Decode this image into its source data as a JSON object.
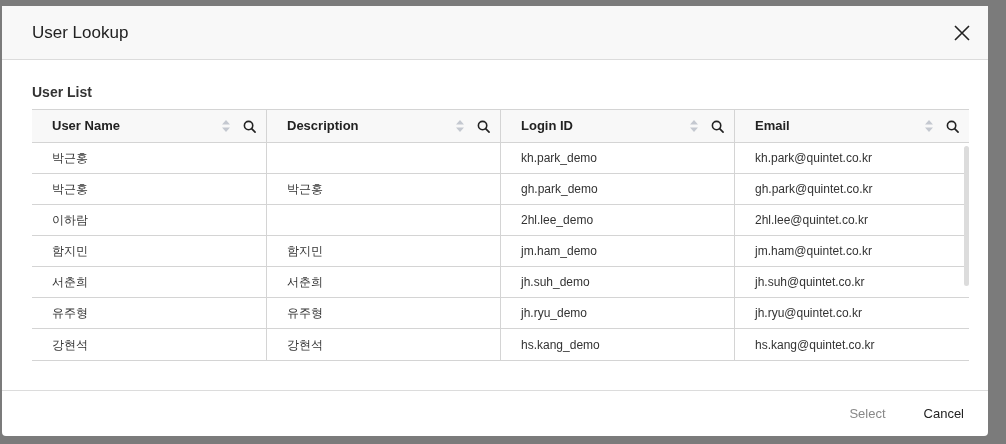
{
  "dialog": {
    "title": "User Lookup"
  },
  "section_title": "User List",
  "table": {
    "columns": [
      "User Name",
      "Description",
      "Login ID",
      "Email"
    ],
    "rows": [
      [
        "박근홍",
        "",
        "kh.park_demo",
        "kh.park@quintet.co.kr"
      ],
      [
        "박근홍",
        "박근홍",
        "gh.park_demo",
        "gh.park@quintet.co.kr"
      ],
      [
        "이하람",
        "",
        "2hl.lee_demo",
        "2hl.lee@quintet.co.kr"
      ],
      [
        "함지민",
        "함지민",
        "jm.ham_demo",
        "jm.ham@quintet.co.kr"
      ],
      [
        "서춘희",
        "서춘희",
        "jh.suh_demo",
        "jh.suh@quintet.co.kr"
      ],
      [
        "유주형",
        "유주형",
        "jh.ryu_demo",
        "jh.ryu@quintet.co.kr"
      ],
      [
        "강현석",
        "강현석",
        "hs.kang_demo",
        "hs.kang@quintet.co.kr"
      ]
    ]
  },
  "buttons": [
    {
      "label": "Select",
      "disabled": true
    },
    {
      "label": "Cancel",
      "disabled": false
    }
  ]
}
